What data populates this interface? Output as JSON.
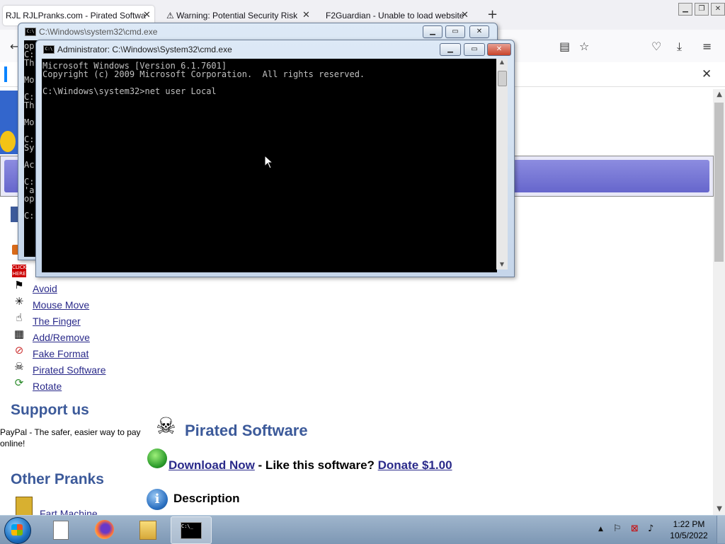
{
  "browser": {
    "tabs": [
      {
        "label": "RJL RJLPranks.com - Pirated Softwa",
        "active": true
      },
      {
        "label": "Warning: Potential Security Risk",
        "active": false
      },
      {
        "label": "F2Guardian - Unable to load website",
        "active": false
      }
    ],
    "new_tab": "+",
    "close_glyph": "✕"
  },
  "page": {
    "side_links": [
      "Avoid",
      "Mouse Move",
      "The Finger",
      "Add/Remove",
      "Fake Format",
      "Pirated Software",
      "Rotate"
    ],
    "support_heading": "Support us",
    "paypal_text": "PayPal - The safer, easier way to pay online!",
    "other_heading": "Other Pranks",
    "other_first": "Fart Machine",
    "title": "Pirated Software",
    "download_label": "Download Now",
    "like_text": " - Like this software? ",
    "donate_label": "Donate $1.00",
    "description_heading": "Description"
  },
  "cmd_back": {
    "title": "C:\\Windows\\system32\\cmd.exe",
    "lines": [
      "op",
      "C:",
      "Th",
      "",
      "Mo",
      "",
      "C:",
      "Th",
      "",
      "Mo",
      "",
      "C:",
      "Sy",
      "",
      "Ac",
      "",
      "C:",
      "'a",
      "op",
      "",
      "C:"
    ]
  },
  "cmd_front": {
    "title": "Administrator: C:\\Windows\\System32\\cmd.exe",
    "lines": [
      "Microsoft Windows [Version 6.1.7601]",
      "Copyright (c) 2009 Microsoft Corporation.  All rights reserved.",
      "",
      "C:\\Windows\\system32>net user Local"
    ]
  },
  "taskbar": {
    "time": "1:22 PM",
    "date": "10/5/2022"
  }
}
